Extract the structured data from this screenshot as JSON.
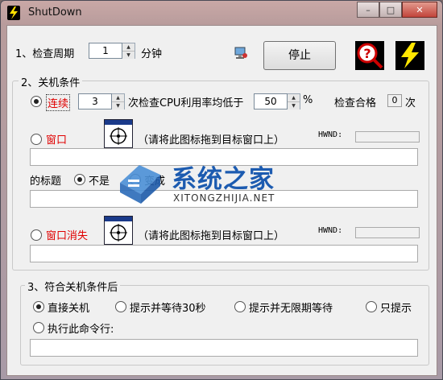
{
  "window": {
    "title": "ShutDown"
  },
  "controls": {
    "minimize": "–",
    "maximize": "□",
    "close": "✕"
  },
  "top": {
    "interval_label": "1、检查周期",
    "interval_value": "1",
    "interval_unit": "分钟",
    "stop_button": "停止"
  },
  "group1": {
    "title": "2、关机条件",
    "continuous_label": "连续",
    "count_value": "3",
    "cpu_text": "次检查CPU利用率均低于",
    "percent_value": "50",
    "percent_unit": "%",
    "pass_label": "检查合格",
    "pass_count": "0",
    "pass_unit": "次",
    "window_label": "窗口",
    "drag_hint": "（请将此图标拖到目标窗口上）",
    "hwnd_label": "HWND:",
    "title_label": "的标题",
    "not_label": "不是",
    "change_label": "变成",
    "window_vanish_label": "窗口消失",
    "drag_hint2": "（请将此图标拖到目标窗口上）",
    "hwnd_label2": "HWND:"
  },
  "group2": {
    "title": "3、符合关机条件后",
    "opt1": "直接关机",
    "opt2": "提示并等待30秒",
    "opt3": "提示并无限期等待",
    "opt4": "只提示",
    "opt5": "执行此命令行:"
  },
  "watermark": {
    "text": "系统之家",
    "sub": "XITONGZHIJIA.NET"
  },
  "colors": {
    "accent_red": "#e00000",
    "title_bar": "#c0a0a0",
    "client_bg": "#f0f0f0"
  }
}
